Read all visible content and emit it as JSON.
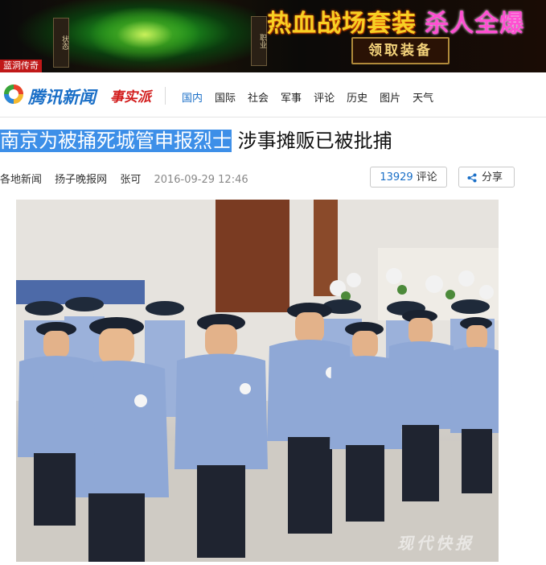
{
  "ad": {
    "badge": "蓝洞传奇",
    "headline_part1": "热血战场套装",
    "headline_part2": "杀人全爆",
    "claim_button": "领取装备",
    "side_label_left": "状态",
    "side_label_right": "职业"
  },
  "site": {
    "logo_text": "腾讯新闻",
    "logo_sub": "事实派",
    "nav": [
      {
        "label": "国内",
        "active": true
      },
      {
        "label": "国际",
        "active": false
      },
      {
        "label": "社会",
        "active": false
      },
      {
        "label": "军事",
        "active": false
      },
      {
        "label": "评论",
        "active": false
      },
      {
        "label": "历史",
        "active": false
      },
      {
        "label": "图片",
        "active": false
      },
      {
        "label": "天气",
        "active": false
      }
    ]
  },
  "article": {
    "title_selected": "南京为被捅死城管申报烈士",
    "title_rest": " 涉事摊贩已被批捕",
    "category": "各地新闻",
    "source": "扬子晚报网",
    "author": "张可",
    "time": "2016-09-29 12:46",
    "comment_count": "13929",
    "comment_label": "评论",
    "share_label": "分享"
  },
  "photo": {
    "watermark": "现代快报"
  },
  "colors": {
    "brand_blue": "#1a6fc7",
    "selection": "#3d8fe8",
    "uniform_blue": "#8fa8d6"
  }
}
